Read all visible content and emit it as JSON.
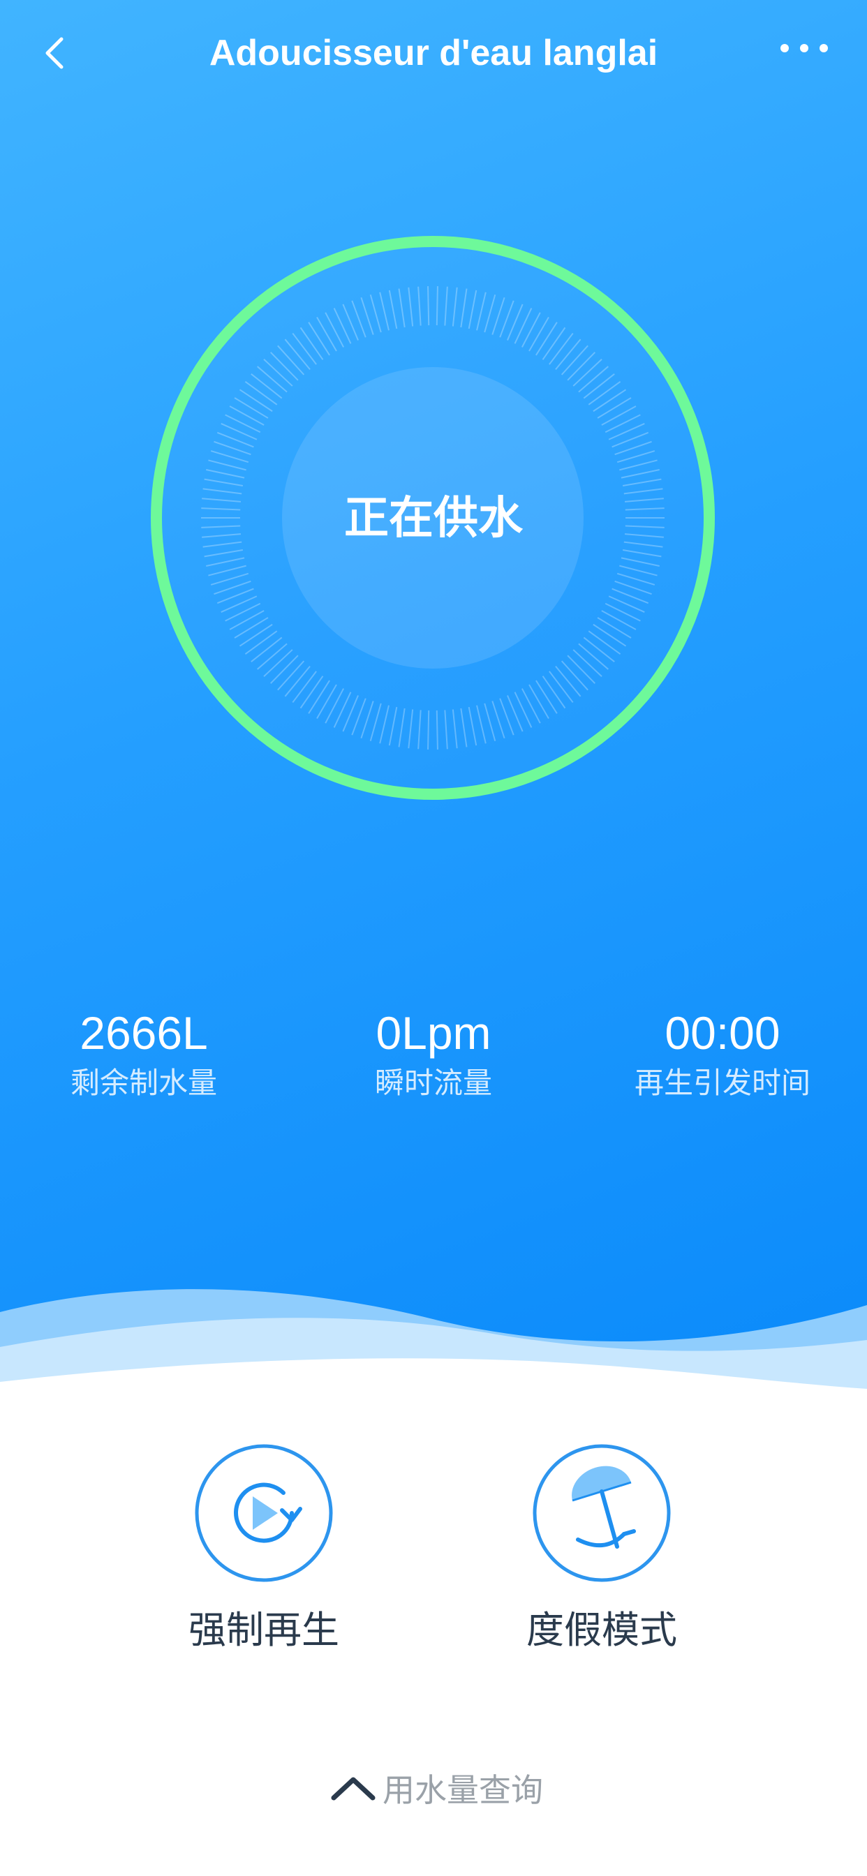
{
  "header": {
    "title": "Adoucisseur d'eau langlai",
    "back_icon": "chevron-left-icon",
    "more_icon": "more-horizontal-icon"
  },
  "status": {
    "text": "正在供水",
    "ring_color": "#6ef99a"
  },
  "stats": [
    {
      "value": "2666L",
      "label": "剩余制水量"
    },
    {
      "value": "0Lpm",
      "label": "瞬时流量"
    },
    {
      "value": "00:00",
      "label": "再生引发时间"
    }
  ],
  "actions": [
    {
      "label": "强制再生",
      "icon": "play-refresh-icon"
    },
    {
      "label": "度假模式",
      "icon": "beach-umbrella-icon"
    }
  ],
  "footer": {
    "usage_label": "用水量查询",
    "icon": "chevron-up-icon"
  },
  "colors": {
    "accent": "#1e90f0",
    "hero_top": "#41b4ff",
    "hero_bottom": "#0a8afa",
    "ring": "#6ef99a"
  }
}
